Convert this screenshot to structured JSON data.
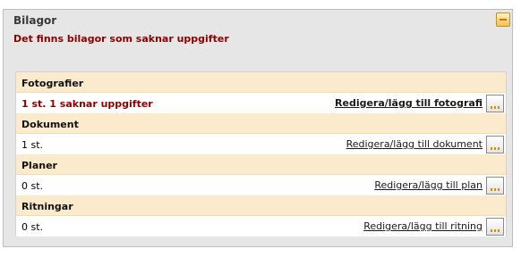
{
  "panel": {
    "title": "Bilagor",
    "warning": "Det finns bilagor som saknar uppgifter"
  },
  "sections": [
    {
      "header": "Fotografier",
      "count": "1 st. 1 saknar uppgifter",
      "link": "Redigera/lägg till fotografi"
    },
    {
      "header": "Dokument",
      "count": "1 st.",
      "link": "Redigera/lägg till dokument"
    },
    {
      "header": "Planer",
      "count": "0 st.",
      "link": "Redigera/lägg till plan"
    },
    {
      "header": "Ritningar",
      "count": "0 st.",
      "link": "Redigera/lägg till ritning"
    }
  ],
  "icons": {
    "collapse": "collapse-icon",
    "more": "ellipsis-icon"
  },
  "colors": {
    "warning": "#8b0000",
    "header_bg": "#fbeacb",
    "panel_bg": "#e6e6e6"
  }
}
